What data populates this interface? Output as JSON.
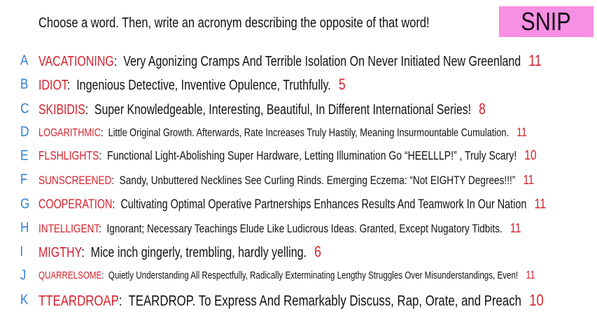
{
  "title": "Choose a word. Then, write an acronym describing the opposite of that word!",
  "badge": "SNIP",
  "colors": {
    "letter": "#2e7fd6",
    "word": "#d8212c",
    "badge_bg": "#f78fe2"
  },
  "rows": [
    {
      "letter": "A",
      "word": "VACATIONING",
      "text": "Very Agonizing Cramps And Terrible Isolation On Never Initiated New Greenland",
      "count": "11"
    },
    {
      "letter": "B",
      "word": "IDIOT",
      "text": "Ingenious Detective, Inventive Opulence, Truthfully.",
      "count": "5"
    },
    {
      "letter": "C",
      "word": "SKIBIDIS",
      "text": "Super Knowledgeable, Interesting, Beautiful, In Different International Series!",
      "count": "8"
    },
    {
      "letter": "D",
      "word": "LOGARITHMIC",
      "text": "Little Original Growth. Afterwards, Rate Increases Truly Hastily, Meaning Insurmountable Cumulation.",
      "count": "11"
    },
    {
      "letter": "E",
      "word": "FLSHLIGHTS",
      "text": "Functional Light-Abolishing Super Hardware, Letting Illumination Go “HEELLLP!” , Truly Scary!",
      "count": "10"
    },
    {
      "letter": "F",
      "word": "SUNSCREENED",
      "text": "Sandy, Unbuttered Necklines See Curling Rinds. Emerging Eczema: “Not EIGHTY Degrees!!!”",
      "count": "11"
    },
    {
      "letter": "G",
      "word": "COOPERATION",
      "text": "Cultivating Optimal Operative Partnerships Enhances Results And Teamwork In Our Nation",
      "count": "11"
    },
    {
      "letter": "H",
      "word": "INTELLIGENT",
      "text": "Ignorant; Necessary Teachings Elude Like Ludicrous Ideas. Granted, Except Nugatory Tidbits.",
      "count": "11"
    },
    {
      "letter": "I",
      "word": "MIGTHY",
      "text": "Mice inch gingerly, trembling, hardly yelling.",
      "count": "6"
    },
    {
      "letter": "J",
      "word": "QUARRELSOME",
      "text": "Quietly Understanding All Respectfully, Radically Exterminating Lengthy Struggles Over Misunderstandings, Even!",
      "count": "11"
    },
    {
      "letter": "K",
      "word": "TTEARDROAP",
      "text": "TEARDROP. To Express And Remarkably Discuss, Rap, Orate, and Preach",
      "count": "10"
    }
  ]
}
